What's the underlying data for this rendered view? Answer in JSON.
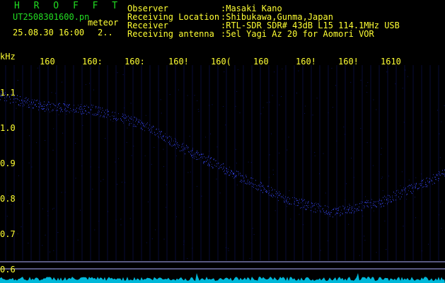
{
  "app": {
    "title": "H R O F F T",
    "filename": "UT2508301600.pn",
    "mode": "meteor",
    "datetime": "25.08.30 16:00",
    "channel": "2..",
    "unit": "kHz"
  },
  "info": [
    {
      "key": "Observer",
      "value": ":Masaki Kano"
    },
    {
      "key": "Receiving Location",
      "value": ":Shibukawa,Gunma,Japan"
    },
    {
      "key": "Receiver",
      "value": ":RTL-SDR SDR# 43dB L15 114.1MHz USB"
    },
    {
      "key": "Receiving antenna",
      "value": ":5el Yagi Az 20 for Aomori VOR"
    }
  ],
  "x_ticks": [
    "160",
    "160:",
    "160:",
    "160!",
    "160(",
    "160",
    "160!",
    "160!",
    "1610"
  ],
  "y_ticks": [
    "1.1",
    "1.0",
    "0.9",
    "0.8",
    "0.7",
    "0.6"
  ],
  "colors": {
    "background": "#000000",
    "text": "#ffff33",
    "title": "#22dd22",
    "signal": "#3a4aff",
    "grid": "#0e1466",
    "spectrum": "#00d8ff",
    "hline": "#b0b0ff"
  }
}
